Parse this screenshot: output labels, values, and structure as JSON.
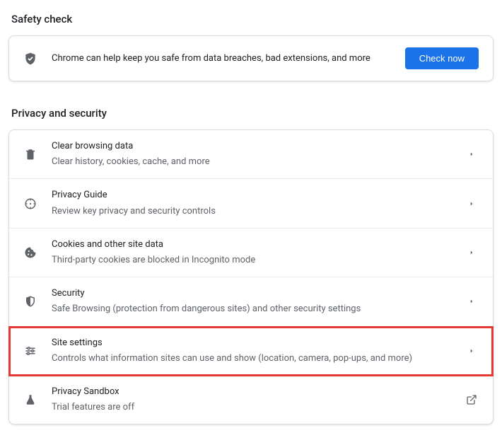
{
  "safety": {
    "header": "Safety check",
    "message": "Chrome can help keep you safe from data breaches, bad extensions, and more",
    "button": "Check now"
  },
  "privacy": {
    "header": "Privacy and security",
    "items": [
      {
        "title": "Clear browsing data",
        "sub": "Clear history, cookies, cache, and more",
        "icon": "trash",
        "trail": "chevron",
        "highlight": false
      },
      {
        "title": "Privacy Guide",
        "sub": "Review key privacy and security controls",
        "icon": "compass",
        "trail": "chevron",
        "highlight": false
      },
      {
        "title": "Cookies and other site data",
        "sub": "Third-party cookies are blocked in Incognito mode",
        "icon": "cookie",
        "trail": "chevron",
        "highlight": false
      },
      {
        "title": "Security",
        "sub": "Safe Browsing (protection from dangerous sites) and other security settings",
        "icon": "shield-half",
        "trail": "chevron",
        "highlight": false
      },
      {
        "title": "Site settings",
        "sub": "Controls what information sites can use and show (location, camera, pop-ups, and more)",
        "icon": "sliders",
        "trail": "chevron",
        "highlight": true
      },
      {
        "title": "Privacy Sandbox",
        "sub": "Trial features are off",
        "icon": "flask",
        "trail": "external",
        "highlight": false
      }
    ]
  }
}
